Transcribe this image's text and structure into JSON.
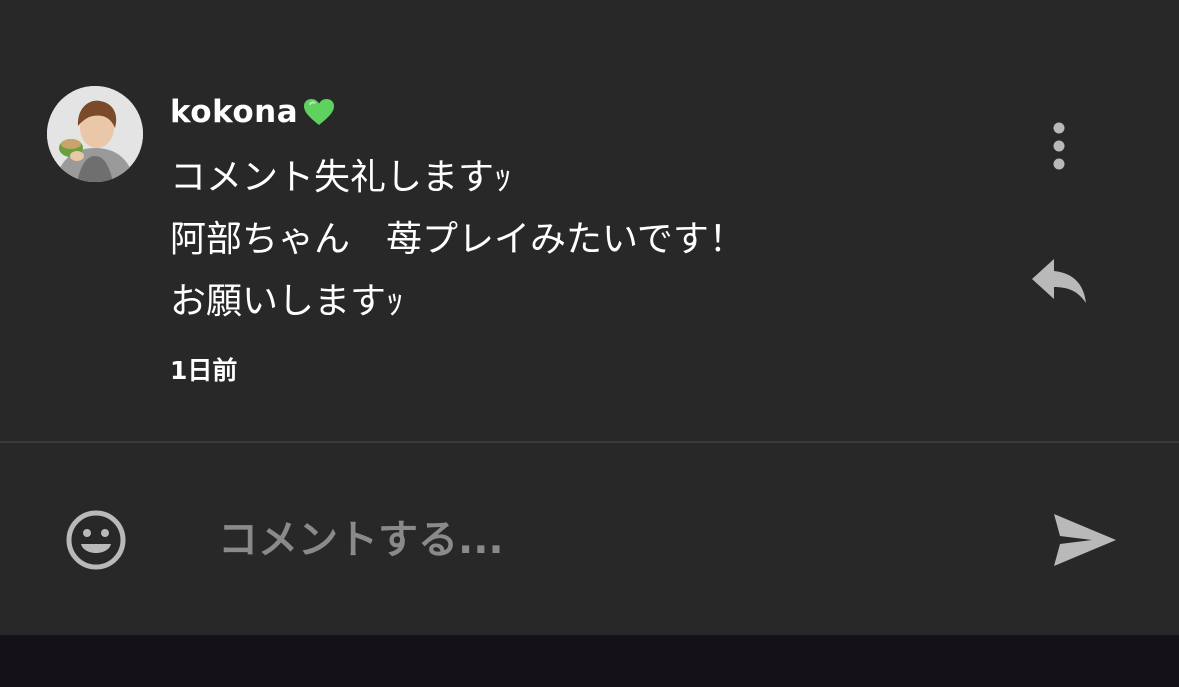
{
  "comment": {
    "username": "kokona",
    "username_emoji": "💚",
    "avatar": "user-avatar-photo",
    "lines": [
      "コメント失礼しますｯ",
      "阿部ちゃん　苺プレイみたいです！",
      "お願いしますｯ"
    ],
    "timestamp": "1日前",
    "icons": {
      "more": "more-vertical-icon",
      "reply": "reply-icon"
    }
  },
  "input_bar": {
    "placeholder": "コメントする...",
    "value": "",
    "icons": {
      "emoji": "smiley-icon",
      "send": "send-icon"
    }
  },
  "colors": {
    "panel_background": "#282828",
    "bottom_background": "#141218",
    "text_primary": "#ffffff",
    "placeholder_text": "#8a8a8a",
    "icon_gray": "#b9b9b9",
    "heart_green": "#5ed15e"
  }
}
